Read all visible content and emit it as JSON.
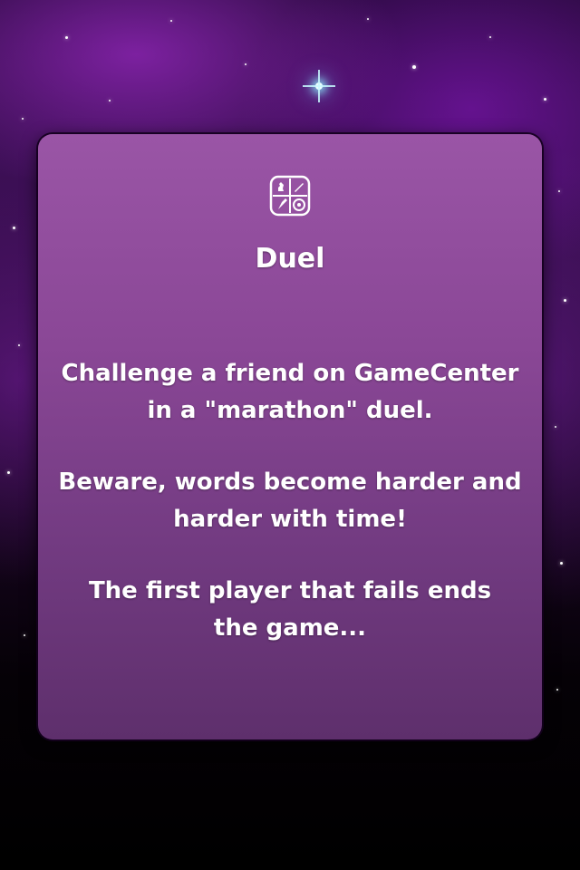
{
  "screen": {
    "title": "Duel",
    "icon": "game-modes-icon",
    "description": [
      [
        "Challenge a friend on GameCenter",
        "in a \"marathon\" duel."
      ],
      [
        "Beware, words become harder and",
        "harder with time!"
      ],
      [
        "The first player that fails ends",
        "the game..."
      ]
    ]
  },
  "colors": {
    "card_top": "#9a55a6",
    "card_bottom": "#5e2f6c",
    "text": "#ffffff",
    "background": "#000000"
  }
}
